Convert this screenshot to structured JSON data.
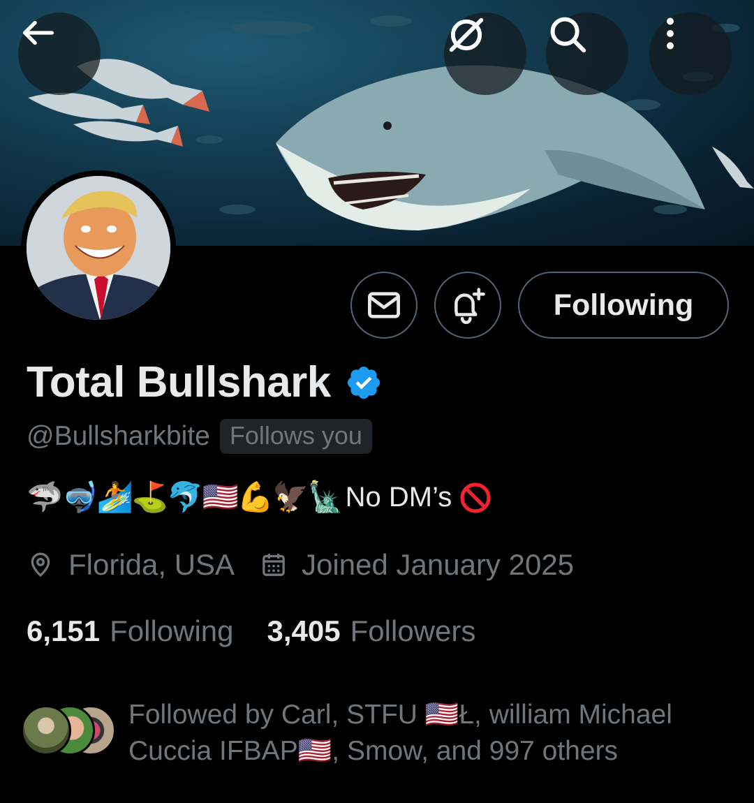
{
  "header": {
    "back_icon": "arrow-left-icon",
    "grok_icon": "grok-icon",
    "search_icon": "search-icon",
    "more_icon": "more-vertical-icon"
  },
  "actions": {
    "message_icon": "envelope-icon",
    "notify_icon": "bell-plus-icon",
    "follow_label": "Following"
  },
  "profile": {
    "name": "Total Bullshark",
    "verified_icon": "verified-badge-icon",
    "handle": "@Bullsharkbite",
    "follows_you": "Follows you",
    "bio_emoji": "🦈🤿🏄⛳🐬🇺🇸💪🦅🗽",
    "bio_text": "No DM’s",
    "bio_end_icon": "prohibited-icon",
    "location": "Florida, USA",
    "joined": "Joined January 2025",
    "following_count": "6,151",
    "following_label": "Following",
    "followers_count": "3,405",
    "followers_label": "Followers",
    "followed_by_line1": "Followed by Carl, STFU 🇺🇸Ł, william Michael",
    "followed_by_line2": "Cuccia IFBAP🇺🇸, Smow, and 997 others"
  },
  "colors": {
    "background": "#000000",
    "text_primary": "#e7e9ea",
    "text_secondary": "#71767b",
    "border": "#536471",
    "verified": "#1d9bf0",
    "prohibited": "#f4212e"
  }
}
